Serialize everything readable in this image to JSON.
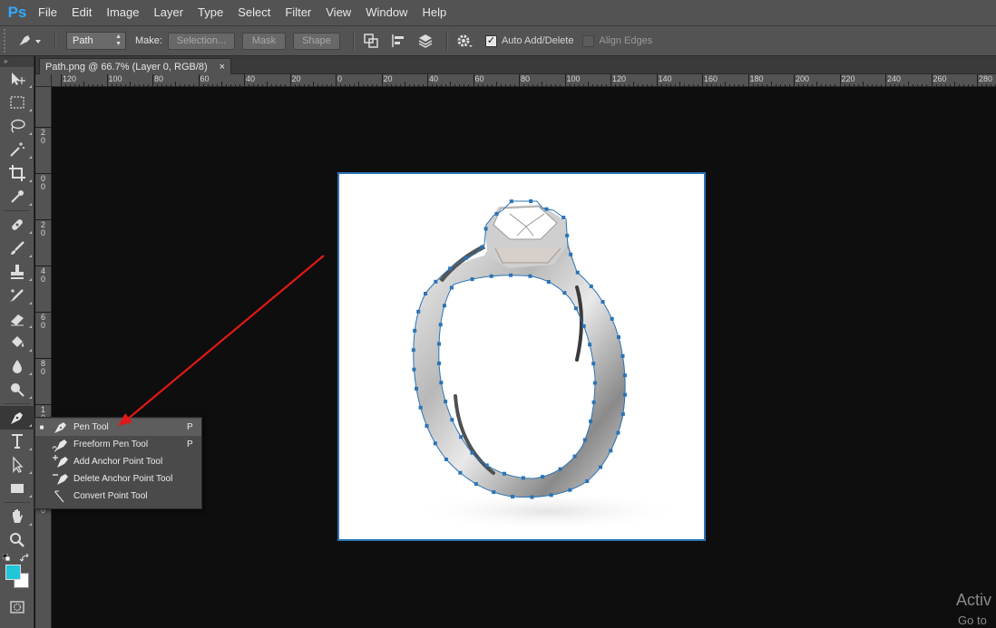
{
  "app": {
    "logo": "Ps"
  },
  "menu": [
    "File",
    "Edit",
    "Image",
    "Layer",
    "Type",
    "Select",
    "Filter",
    "View",
    "Window",
    "Help"
  ],
  "options": {
    "tool_icon": "pen-icon",
    "mode_value": "Path",
    "make_label": "Make:",
    "selection_label": "Selection...",
    "mask_label": "Mask",
    "shape_label": "Shape",
    "auto_add_delete_label": "Auto Add/Delete",
    "auto_add_delete_checked": true,
    "align_edges_label": "Align Edges",
    "align_edges_checked": false
  },
  "document": {
    "tab_title": "Path.png @ 66.7% (Layer 0, RGB/8)",
    "close_glyph": "×"
  },
  "rulers": {
    "top_labels": [
      "120",
      "100",
      "80",
      "60",
      "40",
      "20",
      "0",
      "20",
      "40",
      "60",
      "80",
      "100",
      "120",
      "140",
      "160",
      "180",
      "200",
      "220",
      "240",
      "260",
      "280"
    ],
    "left_labels": [
      "2",
      "0",
      "2",
      "4",
      "6",
      "8",
      "1",
      "1",
      "1"
    ]
  },
  "toolbox": {
    "header": "»",
    "tools": [
      "move-tool",
      "marquee-tool",
      "lasso-tool",
      "magic-wand-tool",
      "crop-tool",
      "eyedropper-tool",
      "healing-brush-tool",
      "brush-tool",
      "clone-stamp-tool",
      "history-brush-tool",
      "eraser-tool",
      "paint-bucket-tool",
      "blur-tool",
      "dodge-tool",
      "pen-tool",
      "type-tool",
      "path-selection-tool",
      "rectangle-tool",
      "hand-tool",
      "zoom-tool"
    ],
    "foreground_color": "#21c5d8",
    "background_color": "#ffffff"
  },
  "flyout": {
    "items": [
      {
        "label": "Pen Tool",
        "shortcut": "P",
        "selected": true,
        "icon": "pen-icon"
      },
      {
        "label": "Freeform Pen Tool",
        "shortcut": "P",
        "selected": false,
        "icon": "freeform-pen-icon"
      },
      {
        "label": "Add Anchor Point Tool",
        "shortcut": "",
        "selected": false,
        "icon": "add-anchor-point-icon"
      },
      {
        "label": "Delete Anchor Point Tool",
        "shortcut": "",
        "selected": false,
        "icon": "delete-anchor-point-icon"
      },
      {
        "label": "Convert Point Tool",
        "shortcut": "",
        "selected": false,
        "icon": "convert-point-icon"
      }
    ]
  },
  "watermark": {
    "line1": "Activ",
    "line2": "Go to"
  },
  "colors": {
    "accent": "#31a8ff",
    "path": "#2b73b5",
    "arrow": "#e01818"
  }
}
